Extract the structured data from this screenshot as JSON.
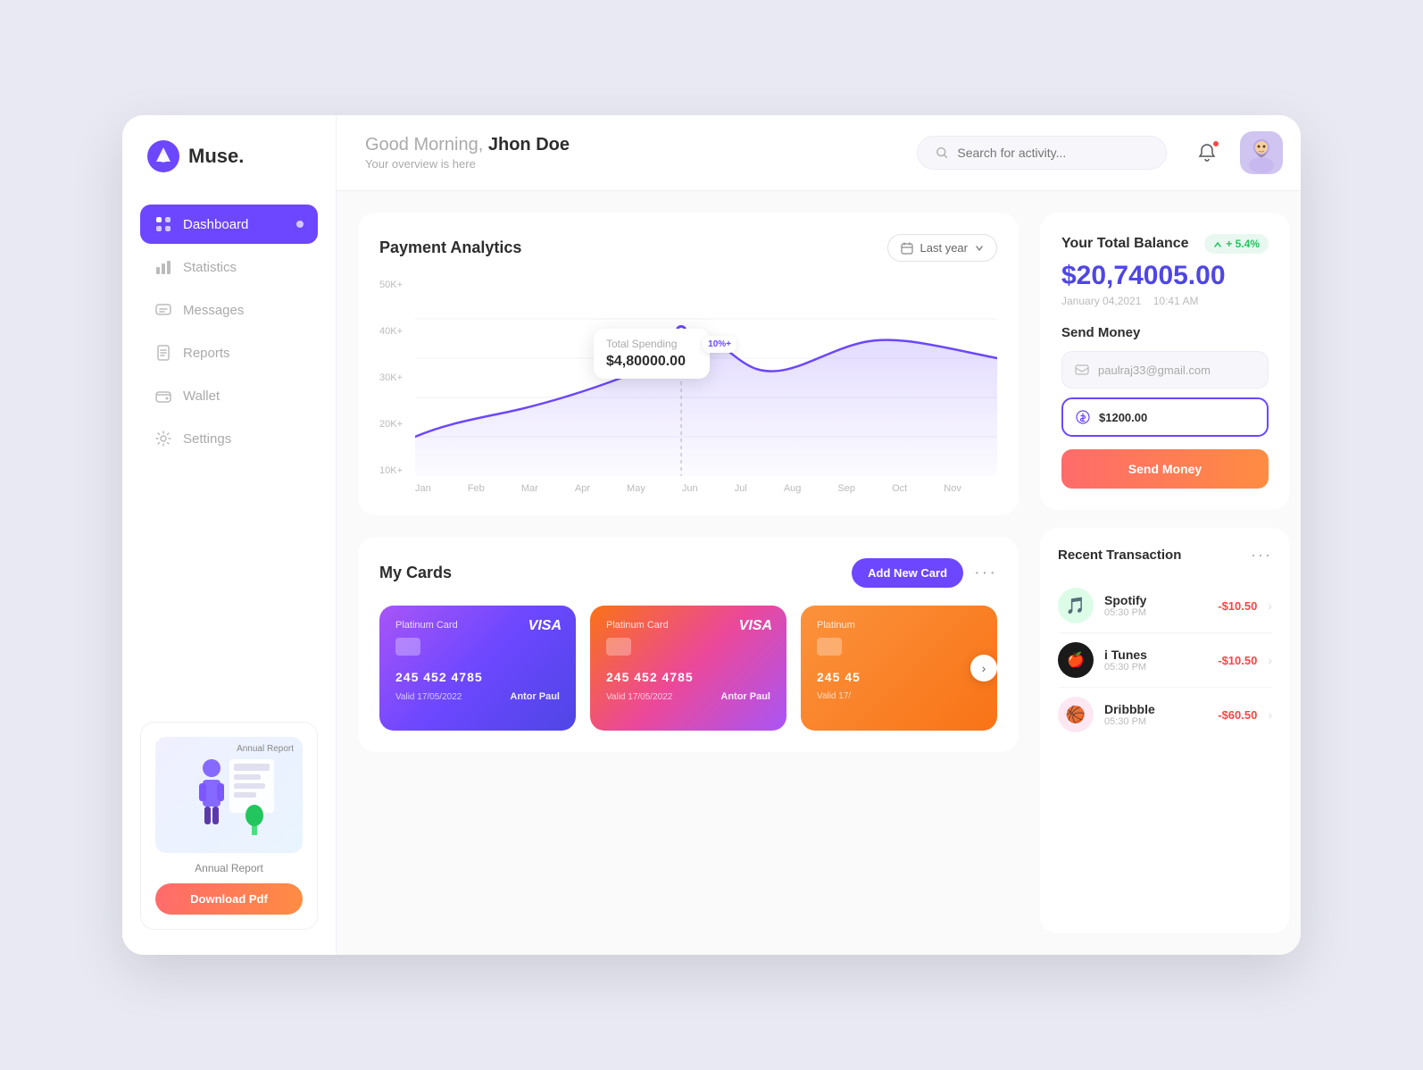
{
  "app": {
    "name": "Muse.",
    "logo_emoji": "🥧"
  },
  "header": {
    "greeting": "Good Morning,",
    "username": "Jhon Doe",
    "subtitle": "Your overview is here",
    "search_placeholder": "Search for activity..."
  },
  "sidebar": {
    "items": [
      {
        "id": "dashboard",
        "label": "Dashboard",
        "active": true
      },
      {
        "id": "statistics",
        "label": "Statistics",
        "active": false
      },
      {
        "id": "messages",
        "label": "Messages",
        "active": false
      },
      {
        "id": "reports",
        "label": "Reports",
        "active": false
      },
      {
        "id": "wallet",
        "label": "Wallet",
        "active": false
      },
      {
        "id": "settings",
        "label": "Settings",
        "active": false
      }
    ],
    "annual_report": {
      "label": "Annual Report",
      "download_btn": "Download Pdf"
    }
  },
  "chart": {
    "title": "Payment Analytics",
    "period": "Last year",
    "y_labels": [
      "50K+",
      "40K+",
      "30K+",
      "20K+",
      "10K+"
    ],
    "x_labels": [
      "Jan",
      "Feb",
      "Mar",
      "Apr",
      "May",
      "Jun",
      "Jul",
      "Aug",
      "Sep",
      "Oct",
      "Nov"
    ],
    "tooltip": {
      "label": "Total Spending",
      "value": "$4,80000.00",
      "badge": "10%+"
    }
  },
  "balance": {
    "title": "Your Total Balance",
    "badge": "+ 5.4%",
    "amount": "$20,74005.00",
    "date": "January 04,2021",
    "time": "10:41 AM"
  },
  "send_money": {
    "title": "Send Money",
    "email": "paulraj33@gmail.com",
    "amount": "$1200.00",
    "button_label": "Send Money"
  },
  "cards": {
    "title": "My Cards",
    "add_button": "Add New Card",
    "items": [
      {
        "type": "Platinum Card",
        "brand": "VISA",
        "number": "245 452 4785",
        "valid": "17/05/2022",
        "holder": "Antor Paul",
        "gradient": "purple"
      },
      {
        "type": "Platinum Card",
        "brand": "VISA",
        "number": "245 452 4785",
        "valid": "17/05/2022",
        "holder": "Antor Paul",
        "gradient": "pink"
      },
      {
        "type": "Platinum",
        "brand": "",
        "number": "245 45",
        "valid": "17/",
        "holder": "",
        "gradient": "orange"
      }
    ]
  },
  "transactions": {
    "title": "Recent Transaction",
    "items": [
      {
        "name": "Spotify",
        "time": "05:30 PM",
        "amount": "-$10.50",
        "icon": "🎵",
        "color": "#22c55e"
      },
      {
        "name": "i Tunes",
        "time": "05:30 PM",
        "amount": "-$10.50",
        "icon": "🍎",
        "color": "#1a1a1a"
      },
      {
        "name": "Dribbble",
        "time": "05:30 PM",
        "amount": "-$60.50",
        "icon": "🏀",
        "color": "#ec4899"
      }
    ]
  }
}
